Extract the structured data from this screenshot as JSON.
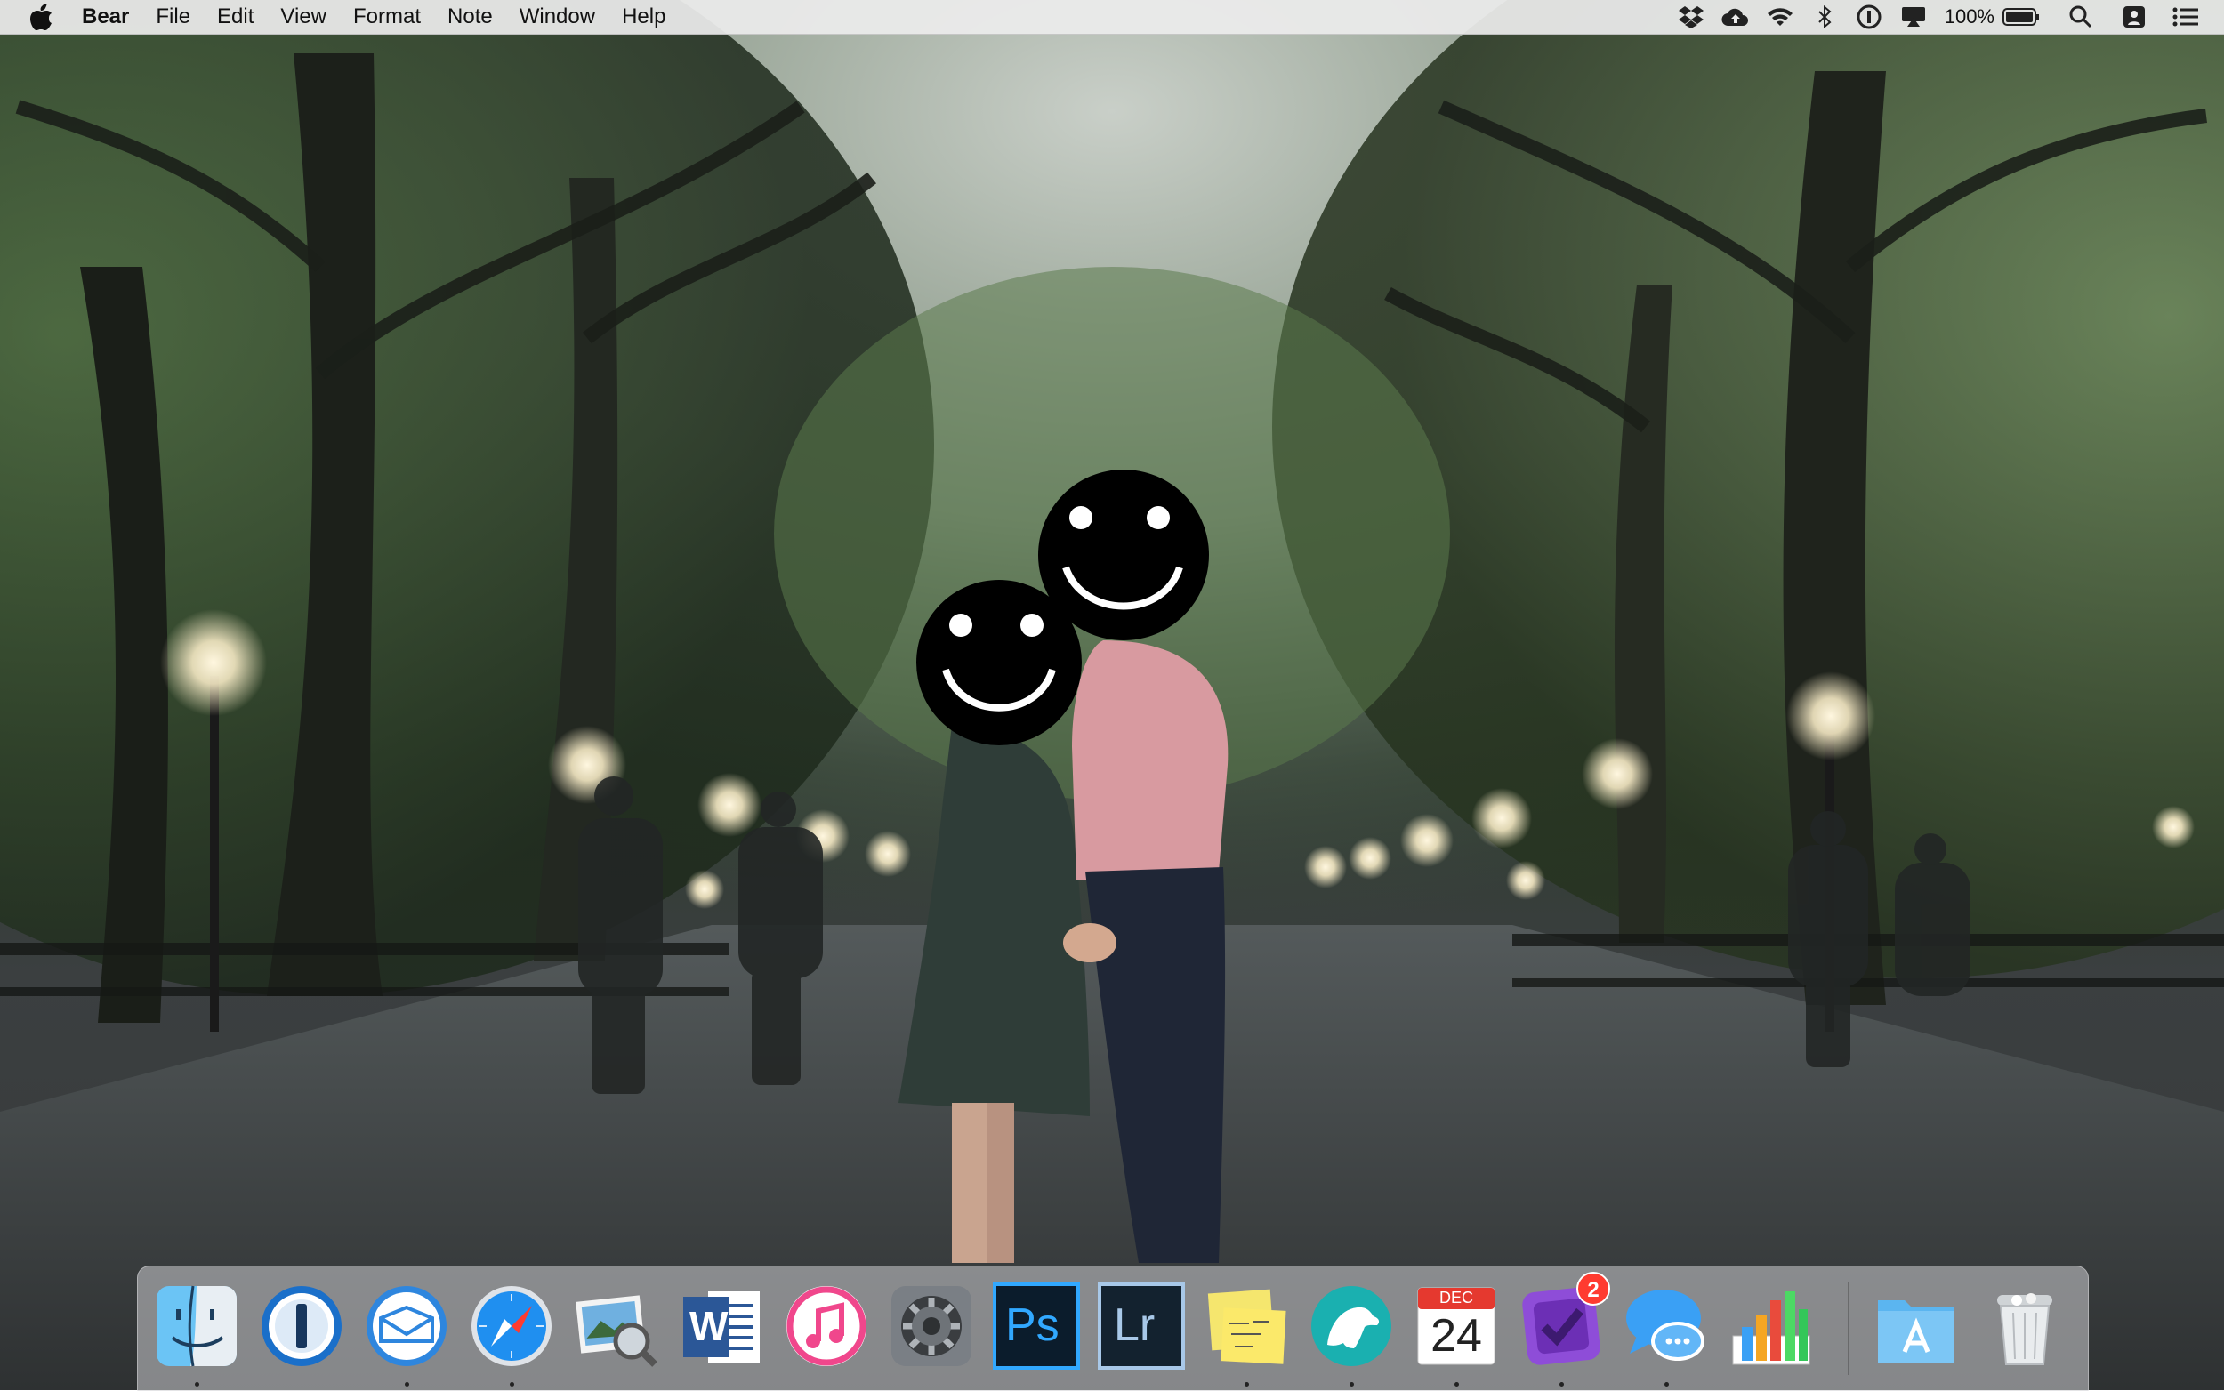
{
  "menubar": {
    "app_name": "Bear",
    "menus": [
      "File",
      "Edit",
      "View",
      "Format",
      "Note",
      "Window",
      "Help"
    ],
    "status_icons": [
      "dropbox-icon",
      "cloud-upload-icon",
      "wifi-icon",
      "bluetooth-icon",
      "1password-mini-icon",
      "airplay-display-icon"
    ],
    "battery_percent": "100%",
    "right_icons": [
      "spotlight-search-icon",
      "user-switch-icon",
      "notification-center-icon"
    ]
  },
  "dock": {
    "apps": [
      {
        "name": "Finder",
        "icon": "finder-icon",
        "running": true
      },
      {
        "name": "1Password",
        "icon": "1password-icon",
        "running": false
      },
      {
        "name": "Airmail",
        "icon": "airmail-icon",
        "running": true
      },
      {
        "name": "Safari",
        "icon": "safari-icon",
        "running": true
      },
      {
        "name": "Preview",
        "icon": "preview-icon",
        "running": false
      },
      {
        "name": "Microsoft Word",
        "icon": "word-icon",
        "label": "W",
        "running": false
      },
      {
        "name": "iTunes",
        "icon": "itunes-icon",
        "running": false
      },
      {
        "name": "System Preferences",
        "icon": "system-preferences-icon",
        "running": false
      },
      {
        "name": "Photoshop",
        "icon": "photoshop-icon",
        "label": "Ps",
        "running": false
      },
      {
        "name": "Lightroom",
        "icon": "lightroom-icon",
        "label": "Lr",
        "running": false
      },
      {
        "name": "Stickies",
        "icon": "stickies-icon",
        "running": true
      },
      {
        "name": "Bear",
        "icon": "bear-icon",
        "running": true
      },
      {
        "name": "Calendar",
        "icon": "calendar-icon",
        "month": "DEC",
        "day": "24",
        "running": true
      },
      {
        "name": "OmniFocus",
        "icon": "omnifocus-icon",
        "badge": "2",
        "running": true
      },
      {
        "name": "Messages",
        "icon": "messages-icon",
        "running": true
      },
      {
        "name": "Numbers",
        "icon": "numbers-icon",
        "running": false
      },
      {
        "name": "Applications",
        "icon": "applications-folder-icon",
        "running": false
      },
      {
        "name": "Trash",
        "icon": "trash-icon",
        "running": false
      }
    ]
  },
  "colors": {
    "menubar_bg": "#ececec",
    "photoshop": "#31a8ff",
    "lightroom": "#a8c8e8",
    "badge": "#ff3b30"
  }
}
